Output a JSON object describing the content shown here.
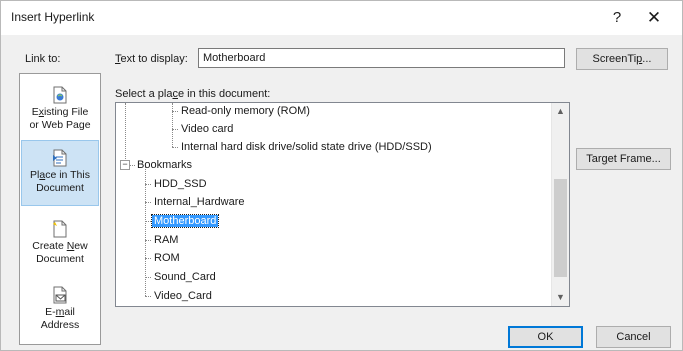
{
  "dialog": {
    "title": "Insert Hyperlink",
    "help_label": "?",
    "close_label": "✕"
  },
  "link_to": {
    "label": "Link to:",
    "items": [
      {
        "line1_pre": "E",
        "line1_ul": "x",
        "line1_post": "isting File",
        "line2": "or Web Page",
        "icon": "web-page-icon",
        "selected": false
      },
      {
        "line1_pre": "Pl",
        "line1_ul": "a",
        "line1_post": "ce in This",
        "line2": "Document",
        "icon": "place-in-document-icon",
        "selected": true
      },
      {
        "line1_pre": "Create ",
        "line1_ul": "N",
        "line1_post": "ew",
        "line2": "Document",
        "icon": "new-document-icon",
        "selected": false
      },
      {
        "line1_pre": "E-",
        "line1_ul": "m",
        "line1_post": "ail",
        "line2": "Address",
        "icon": "email-address-icon",
        "selected": false
      }
    ]
  },
  "text_to_display": {
    "label_ul": "T",
    "label_rest": "ext to display:",
    "value": "Motherboard"
  },
  "select_place": {
    "label_pre": "Select a pla",
    "label_ul": "c",
    "label_post": "e in this document:"
  },
  "tree": {
    "rows": [
      {
        "text": "Read-only memory (ROM)"
      },
      {
        "text": "Video card"
      },
      {
        "text": "Internal hard disk drive/solid state drive (HDD/SSD)"
      },
      {
        "text": "Bookmarks",
        "expander": "−"
      },
      {
        "text": "HDD_SSD"
      },
      {
        "text": "Internal_Hardware"
      },
      {
        "text": "Motherboard",
        "selected": true
      },
      {
        "text": "RAM"
      },
      {
        "text": "ROM"
      },
      {
        "text": "Sound_Card"
      },
      {
        "text": "Video_Card"
      }
    ]
  },
  "buttons": {
    "screentip_pre": "ScreenTi",
    "screentip_ul": "p",
    "screentip_post": "...",
    "target_pre": "Tar",
    "target_ul": "g",
    "target_post": "et Frame...",
    "ok": "OK",
    "cancel": "Cancel"
  }
}
